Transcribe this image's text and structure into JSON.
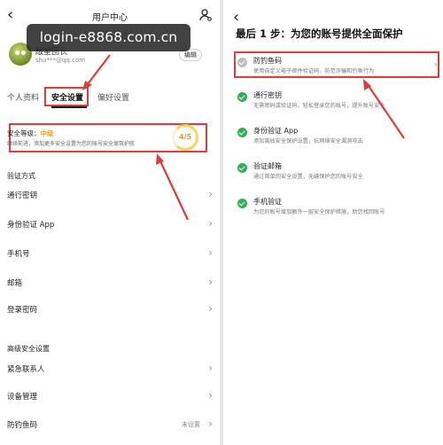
{
  "left": {
    "nav": {
      "back_glyph": "‹",
      "title": "用户中心",
      "user_icon": "user-settings-icon"
    },
    "watermark": "login-e8868.com.cn",
    "profile": {
      "nickname": "敲星团长",
      "email": "shu***@qq.com",
      "edit_label": "编辑"
    },
    "tabs": [
      "个人资料",
      "安全设置",
      "偏好设置"
    ],
    "active_tab": 1,
    "security_level": {
      "label": "安全等级：",
      "value": "中级",
      "description": "继续前进，添加更多安全设置为您的账号安全保驾护航",
      "score": "4/5",
      "score_fraction": 0.8
    },
    "verification": {
      "title": "验证方式",
      "items": [
        {
          "label": "通行密钥"
        },
        {
          "label": "身份验证 App"
        },
        {
          "label": "手机号"
        },
        {
          "label": "邮箱"
        },
        {
          "label": "登录密码"
        }
      ]
    },
    "advanced": {
      "title": "高级安全设置",
      "items": [
        {
          "label": "紧急联系人",
          "aux": ""
        },
        {
          "label": "设备管理",
          "aux": ""
        },
        {
          "label": "防钓鱼码",
          "aux": "未设置"
        }
      ]
    },
    "accent_color": "#e23a3a",
    "level_color": "#e8a114"
  },
  "right": {
    "back_glyph": "‹",
    "heading": "最后 1 步：为您的账号提供全面保护",
    "items": [
      {
        "title": "防钓鱼码",
        "desc": "使用自定义电子邮件验证码，防范诈骗和钓鱼行为",
        "status": "pending",
        "chevron": "›"
      },
      {
        "title": "通行密钥",
        "desc": "无需密码或验证码，轻松登录您的账号，提升账号安全",
        "status": "done",
        "chevron": ""
      },
      {
        "title": "身份验证 App",
        "desc": "添加离线安全保护设置，抗网络安全漏洞攻击",
        "status": "done",
        "chevron": ""
      },
      {
        "title": "验证邮箱",
        "desc": "通过简单的安全设置，无缝保护您的账号安全",
        "status": "done",
        "chevron": ""
      },
      {
        "title": "手机验证",
        "desc": "为您的账号增加额外一层安全保护措施，助您找回账号",
        "status": "done",
        "chevron": ""
      }
    ],
    "done_color": "#32b057",
    "pending_color": "#bdbdbd"
  },
  "chevron_glyph": "›"
}
